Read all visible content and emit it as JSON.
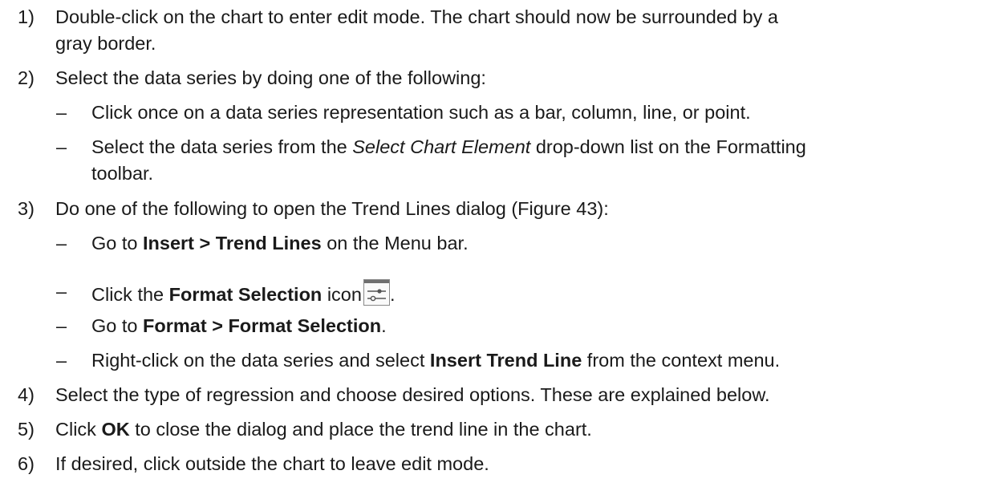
{
  "steps": [
    {
      "num": "1)",
      "lines": [
        "Double-click on the chart to enter edit mode. The chart should now be surrounded by a",
        "gray border."
      ]
    },
    {
      "num": "2)",
      "text": "Select the data series by doing one of the following:",
      "subs": [
        {
          "dash": "–",
          "text": "Click once on a data series representation such as a bar, column, line, or point."
        },
        {
          "dash": "–",
          "pre": "Select the data series from the ",
          "em": "Select Chart Element",
          "post": " drop-down list on the Formatting",
          "cont": "toolbar."
        }
      ]
    },
    {
      "num": "3)",
      "text": "Do one of the following to open the Trend Lines dialog (Figure 43):",
      "subs": [
        {
          "dash": "–",
          "pre": "Go to ",
          "bold": "Insert > Trend Lines",
          "post": " on the Menu bar."
        },
        {
          "dash": "–",
          "pre": "Click the ",
          "bold": "Format Selection",
          "post": " icon",
          "tail": ".",
          "icon": "format-selection-icon"
        },
        {
          "dash": "–",
          "pre": "Go to ",
          "bold": "Format > Format Selection",
          "post": "."
        },
        {
          "dash": "–",
          "pre": "Right-click on the data series and select ",
          "bold": "Insert Trend Line",
          "post": " from the context menu."
        }
      ]
    },
    {
      "num": "4)",
      "text": "Select the type of regression and choose desired options. These are explained below."
    },
    {
      "num": "5)",
      "pre": "Click ",
      "bold": "OK",
      "post": " to close the dialog and place the trend line in the chart."
    },
    {
      "num": "6)",
      "text": "If desired, click outside the chart to leave edit mode."
    }
  ]
}
